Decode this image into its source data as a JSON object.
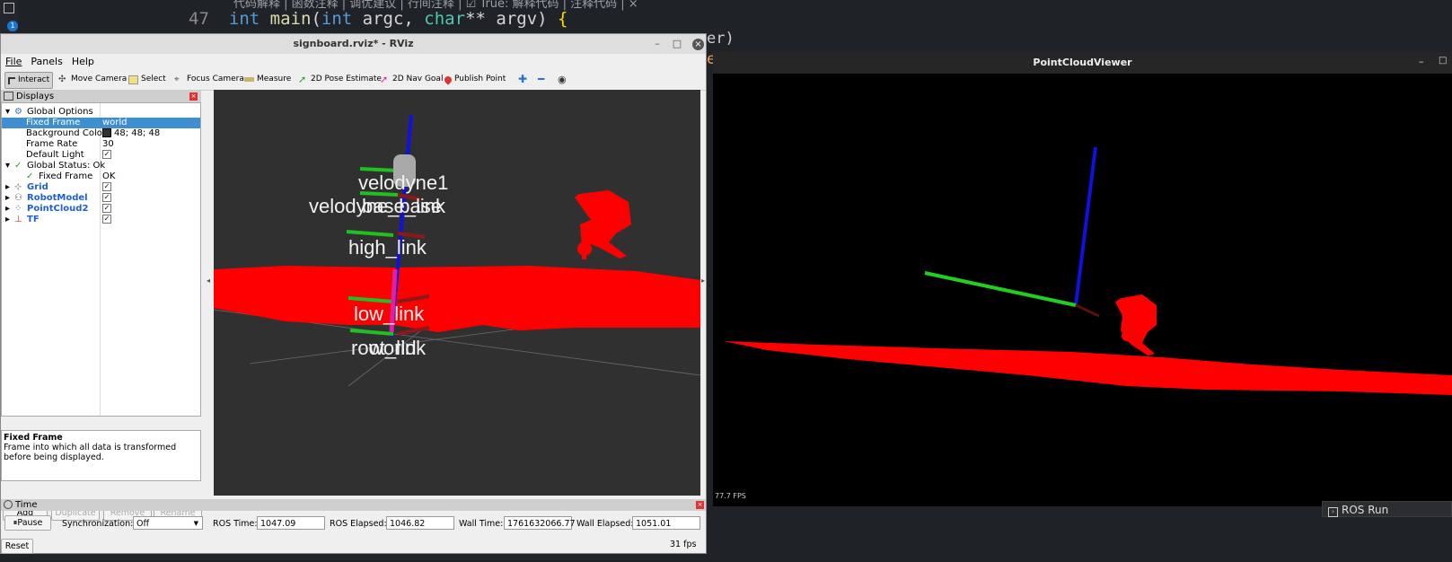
{
  "editor": {
    "top_text": "代码解释 | 函数注释 | 调优建议 | 行间注释 | ☑ True: 解释代码 | 注释代码 | ×",
    "line_number": "47",
    "code_kw1": "int",
    "code_fn": "main",
    "code_paren_open": "(",
    "code_kw2": "int",
    "code_argc": " argc, ",
    "code_char": "char",
    "code_rest": "** argv) ",
    "code_brace": "{",
    "fragment1": "er)",
    "fragment2": "e",
    "badge": "1"
  },
  "rviz": {
    "title": "signboard.rviz* - RViz",
    "menu": [
      "File",
      "Panels",
      "Help"
    ],
    "toolbar": {
      "interact": "Interact",
      "move_camera": "Move Camera",
      "select": "Select",
      "focus_camera": "Focus Camera",
      "measure": "Measure",
      "pose_estimate": "2D Pose Estimate",
      "nav_goal": "2D Nav Goal",
      "publish_point": "Publish Point"
    },
    "displays_title": "Displays",
    "tree": {
      "global_options": "Global Options",
      "fixed_frame_label": "Fixed Frame",
      "fixed_frame_value": "world",
      "bg_color_label": "Background Color",
      "bg_color_value": "48; 48; 48",
      "frame_rate_label": "Frame Rate",
      "frame_rate_value": "30",
      "default_light_label": "Default Light",
      "global_status": "Global Status: Ok",
      "status_fixed_frame": "Fixed Frame",
      "status_ok": "OK",
      "grid": "Grid",
      "robot_model": "RobotModel",
      "pointcloud2": "PointCloud2",
      "tf": "TF"
    },
    "help_title": "Fixed Frame",
    "help_text": "Frame into which all data is transformed before being displayed.",
    "buttons": {
      "add": "Add",
      "duplicate": "Duplicate",
      "remove": "Remove",
      "rename": "Rename"
    },
    "frame_labels": {
      "velodyne1": "velodyne1",
      "velodyne_base": "velodyne_base",
      "base_link": "base_link",
      "high_link": "high_link",
      "low_link": "low_link",
      "root_link": "root_link",
      "world": "world"
    },
    "time_title": "Time",
    "time": {
      "pause": "Pause",
      "sync_label": "Synchronization:",
      "sync_value": "Off",
      "ros_time_label": "ROS Time:",
      "ros_time": "1047.09",
      "ros_elapsed_label": "ROS Elapsed:",
      "ros_elapsed": "1046.82",
      "wall_time_label": "Wall Time:",
      "wall_time": "1761632066.77",
      "wall_elapsed_label": "Wall Elapsed:",
      "wall_elapsed": "1051.01"
    },
    "reset": "Reset",
    "fps": "31 fps"
  },
  "pcv": {
    "title": "PointCloudViewer",
    "fps": "77.7 FPS"
  },
  "ros_run": "ROS Run"
}
